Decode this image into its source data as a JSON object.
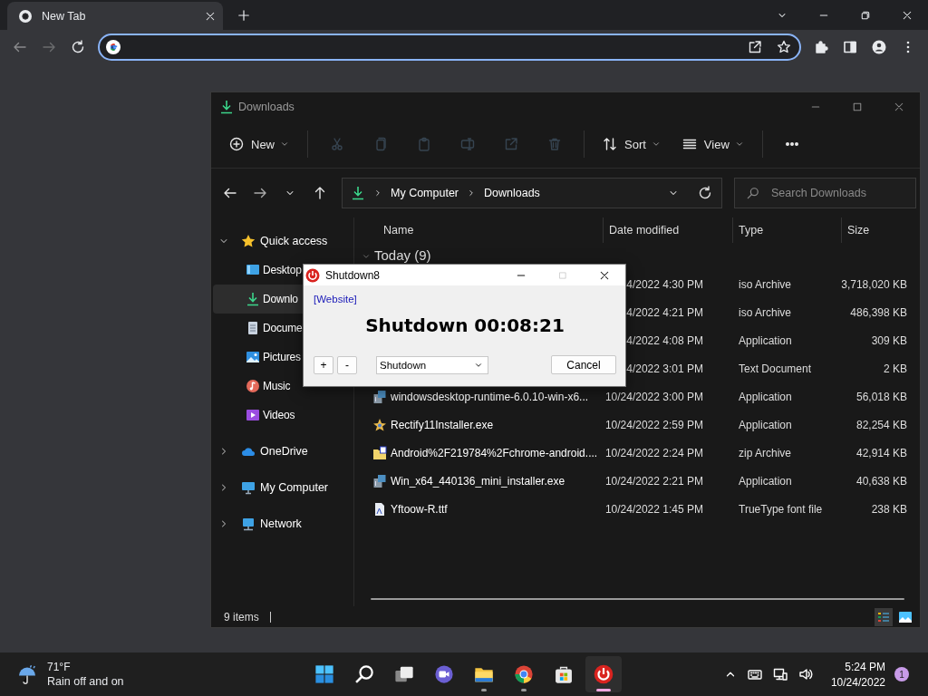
{
  "browser": {
    "tab": {
      "title": "New Tab"
    }
  },
  "explorer": {
    "title": "Downloads",
    "toolbar": [
      {
        "kind": "new",
        "label": "New",
        "disabled": false
      },
      {
        "kind": "cut",
        "disabled": true
      },
      {
        "kind": "copy",
        "disabled": true
      },
      {
        "kind": "paste",
        "disabled": true
      },
      {
        "kind": "rename",
        "disabled": true
      },
      {
        "kind": "share",
        "disabled": true
      },
      {
        "kind": "delete",
        "disabled": true
      },
      {
        "kind": "sort",
        "label": "Sort",
        "disabled": false
      },
      {
        "kind": "view",
        "label": "View",
        "disabled": false
      },
      {
        "kind": "more",
        "disabled": false
      }
    ],
    "breadcrumb": [
      "My Computer",
      "Downloads"
    ],
    "search": {
      "placeholder": "Search Downloads"
    },
    "sidebar": [
      {
        "label": "Quick access",
        "kind": "star",
        "expanded": true,
        "selected": false,
        "children": [
          {
            "label": "Desktop",
            "kind": "desktop",
            "selected": false
          },
          {
            "label": "Downlo",
            "kind": "download",
            "selected": true
          },
          {
            "label": "Docume",
            "kind": "document",
            "selected": false
          },
          {
            "label": "Pictures",
            "kind": "pictures",
            "selected": false
          },
          {
            "label": "Music",
            "kind": "music",
            "selected": false
          },
          {
            "label": "Videos",
            "kind": "videos",
            "selected": false
          }
        ]
      },
      {
        "label": "OneDrive",
        "kind": "cloud",
        "expanded": false,
        "selected": false
      },
      {
        "label": "My Computer",
        "kind": "computer",
        "expanded": false,
        "selected": false
      },
      {
        "label": "Network",
        "kind": "network",
        "expanded": false,
        "selected": false
      }
    ],
    "columns": [
      "Name",
      "Date modified",
      "Type",
      "Size"
    ],
    "group": {
      "label": "Today (9)",
      "expanded": true
    },
    "rows": [
      {
        "date": "4/2022 4:30 PM",
        "type": "iso Archive",
        "size": "3,718,020 KB"
      },
      {
        "date": "4/2022 4:21 PM",
        "type": "iso Archive",
        "size": "486,398 KB"
      },
      {
        "date": "4/2022 4:08 PM",
        "type": "Application",
        "size": "309 KB"
      },
      {
        "date": "4/2022 3:01 PM",
        "type": "Text Document",
        "size": "2 KB"
      },
      {
        "kind": "installer",
        "name": "windowsdesktop-runtime-6.0.10-win-x6...",
        "date": "10/24/2022 3:00 PM",
        "type": "Application",
        "size": "56,018 KB"
      },
      {
        "kind": "rectify",
        "name": "Rectify11Installer.exe",
        "date": "10/24/2022 2:59 PM",
        "type": "Application",
        "size": "82,254 KB"
      },
      {
        "kind": "zip",
        "name": "Android%2F219784%2Fchrome-android....",
        "date": "10/24/2022 2:24 PM",
        "type": "zip Archive",
        "size": "42,914 KB"
      },
      {
        "kind": "installer",
        "name": "Win_x64_440136_mini_installer.exe",
        "date": "10/24/2022 2:21 PM",
        "type": "Application",
        "size": "40,638 KB"
      },
      {
        "kind": "font",
        "name": "Yftoow-R.ttf",
        "date": "10/24/2022 1:45 PM",
        "type": "TrueType font file",
        "size": "238 KB"
      }
    ],
    "status": "9 items"
  },
  "dialog": {
    "title": "Shutdown8",
    "link": "[Website]",
    "countdown": "Shutdown 00:08:21",
    "step_buttons": [
      "+",
      "-"
    ],
    "select": {
      "value": "Shutdown"
    },
    "cancel": "Cancel"
  },
  "taskbar": {
    "weather": {
      "temperature": "71°F",
      "condition": "Rain off and on"
    },
    "apps": [
      {
        "kind": "start",
        "running": false,
        "selected": false
      },
      {
        "kind": "search",
        "running": false,
        "selected": false
      },
      {
        "kind": "taskview",
        "running": false,
        "selected": false
      },
      {
        "kind": "meet",
        "running": false,
        "selected": false
      },
      {
        "kind": "folder",
        "running": true,
        "selected": false
      },
      {
        "kind": "browser",
        "running": true,
        "selected": false
      },
      {
        "kind": "store",
        "running": false,
        "selected": false
      },
      {
        "kind": "power",
        "running": true,
        "selected": true
      }
    ],
    "time": "5:24 PM",
    "date": "10/24/2022",
    "notifications": "1"
  }
}
